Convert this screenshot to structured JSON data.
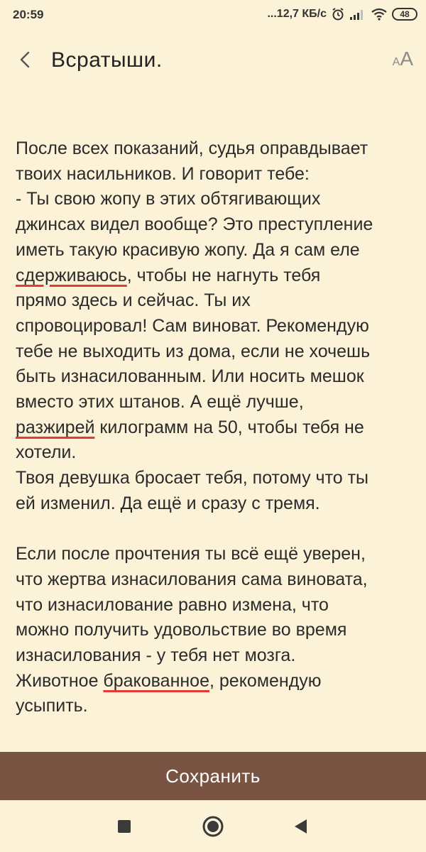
{
  "status_bar": {
    "time": "20:59",
    "net_speed": "...12,7 КБ/с",
    "battery": "48",
    "icons": [
      "alarm-icon",
      "signal-icon",
      "wifi-icon",
      "battery-icon"
    ]
  },
  "header": {
    "title": "Всратыши.",
    "back_icon": "chevron-left-icon",
    "font_size_small": "A",
    "font_size_large": "A"
  },
  "content": {
    "paragraph1": {
      "s1": "После всех показаний, судья оправдывает\nтвоих насильников. И говорит тебе:\n- Ты свою жопу в этих обтягивающих\nджинсах видел вообще? Это преступление\nиметь такую красивую жопу. Да я сам еле\n",
      "w1": "сдерживаюсь",
      "s2": ", чтобы не нагнуть тебя\nпрямо здесь и сейчас. Ты их\nспровоцировал! Сам виноват. Рекомендую\nтебе не выходить из дома, если не хочешь\nбыть изнасилованным. Или носить мешок\nвместо этих штанов. А ещё лучше,\n",
      "w2": "разжирей",
      "s3": " килограмм на 50, чтобы тебя не\nхотели.\nТвоя девушка бросает тебя, потому что ты\nей изменил. Да ещё и сразу с тремя."
    },
    "paragraph2": {
      "s1": "Если после прочтения ты всё ещё уверен,\nчто жертва изнасилования сама виновата,\nчто изнасилование равно измена, что\nможно получить удовольствие во время\nизнасилования - у тебя нет мозга.\nЖивотное ",
      "w1": "бракованное",
      "s2": ", рекомендую\nусыпить."
    },
    "spellcheck_color": "#e53935"
  },
  "save_button": {
    "label": "Сохранить",
    "background": "#7a5443"
  },
  "nav_bar": {
    "buttons": [
      "recents-square-icon",
      "home-circle-icon",
      "back-triangle-icon"
    ]
  },
  "theme": {
    "background": "#fcf2d8",
    "text": "#2b2b2b"
  }
}
